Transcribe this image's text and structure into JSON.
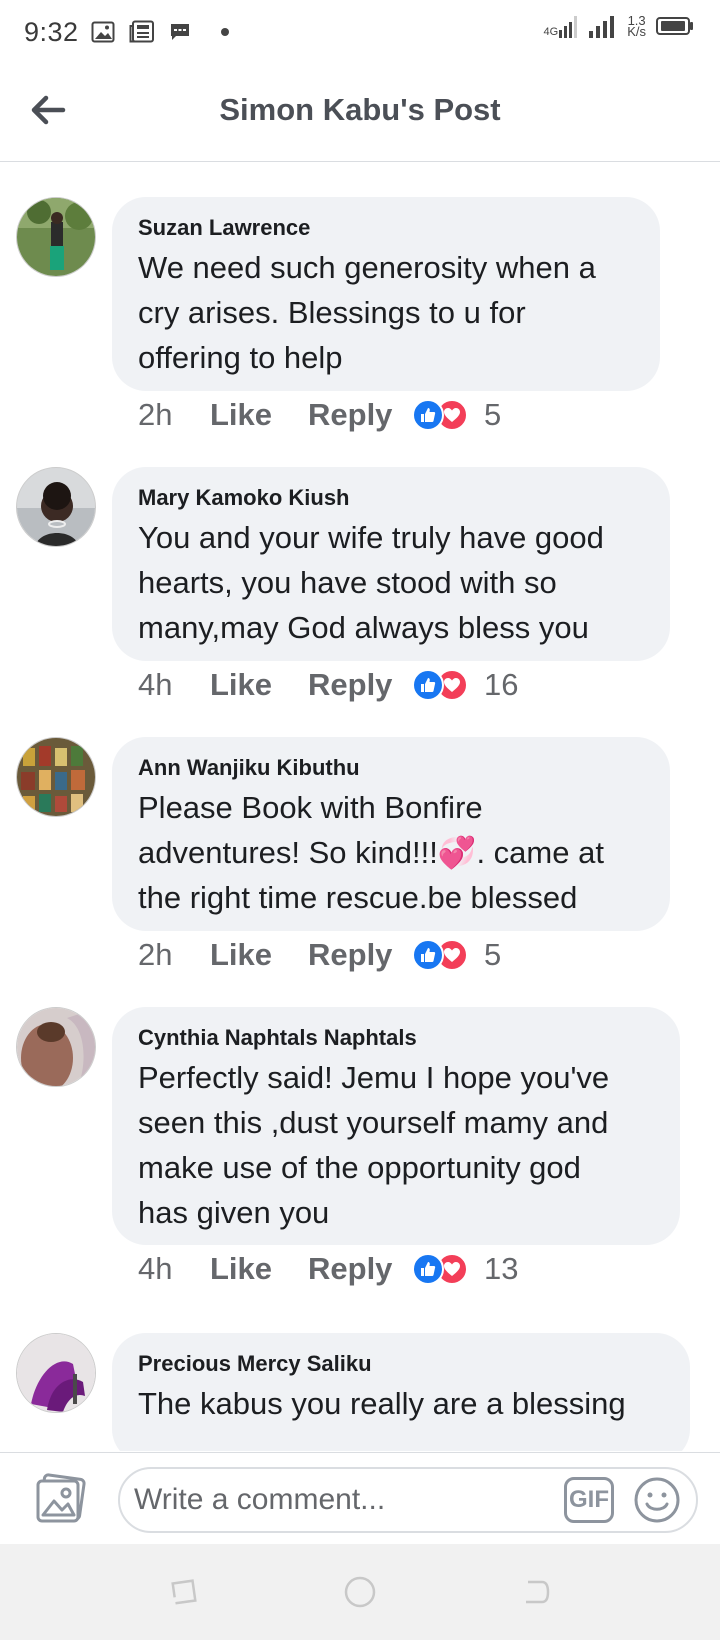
{
  "status_bar": {
    "time": "9:32",
    "network_type": "4G",
    "net_speed_value": "1.3",
    "net_speed_unit": "K/s",
    "icons": [
      "gallery-icon",
      "news-icon",
      "message-icon",
      "dot-icon",
      "signal-icon",
      "battery-icon"
    ]
  },
  "header": {
    "title": "Simon Kabu's Post",
    "back_icon": "arrow-left-icon"
  },
  "comments": [
    {
      "author": "Suzan Lawrence",
      "text_lines": [
        "We need such generosity when a",
        "cry arises. Blessings to u for",
        "offering to help"
      ],
      "time": "2h",
      "like_label": "Like",
      "reply_label": "Reply",
      "reaction_count": "5"
    },
    {
      "author": "Mary Kamoko Kiush",
      "text_lines": [
        "You and your wife truly have good",
        "hearts, you have stood with so",
        "many,may God always bless you"
      ],
      "time": "4h",
      "like_label": "Like",
      "reply_label": "Reply",
      "reaction_count": "16"
    },
    {
      "author": "Ann Wanjiku Kibuthu",
      "text_lines": [
        "Please Book with Bonfire",
        "adventures! So kind!!!💞. came at",
        "the right time rescue.be blessed"
      ],
      "time": "2h",
      "like_label": "Like",
      "reply_label": "Reply",
      "reaction_count": "5"
    },
    {
      "author": "Cynthia Naphtals Naphtals",
      "text_lines": [
        "Perfectly said! Jemu I hope you've",
        "seen this ,dust yourself mamy and",
        "make use of the opportunity god",
        "has given you"
      ],
      "time": "4h",
      "like_label": "Like",
      "reply_label": "Reply",
      "reaction_count": "13"
    },
    {
      "author": "Precious Mercy Saliku",
      "text_lines": [
        "The kabus you really are a blessing"
      ]
    }
  ],
  "composer": {
    "placeholder": "Write a comment...",
    "gif_label": "GIF"
  },
  "colors": {
    "bubble": "#f0f2f5",
    "like_blue": "#1877f2",
    "love_red": "#f33e58",
    "meta_gray": "#65676b"
  }
}
